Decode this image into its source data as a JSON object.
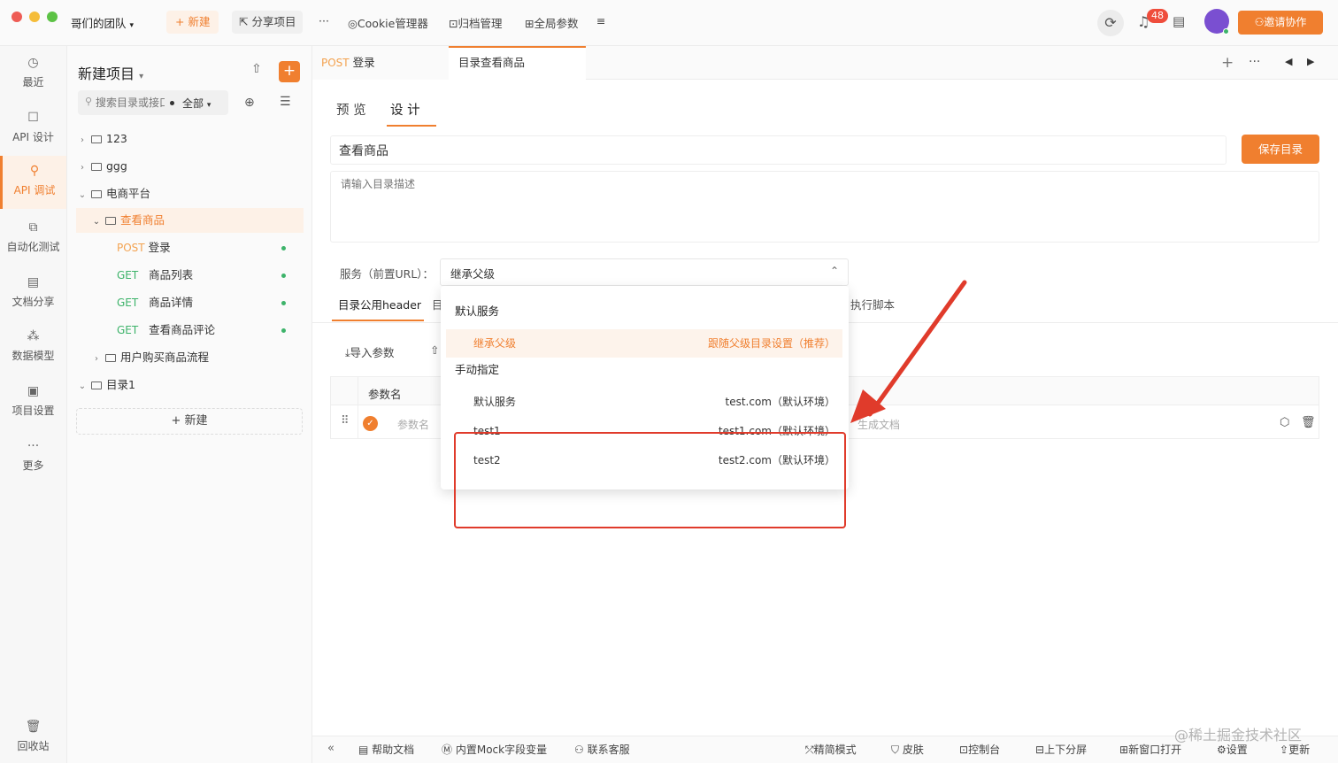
{
  "window": {
    "team": "哥们的团队",
    "new": "+ 新建",
    "share": "分享项目",
    "more": "···",
    "cookie": "Cookie管理器",
    "archive": "归档管理",
    "globals": "全局参数",
    "notify_count": "48",
    "invite": "邀请协作"
  },
  "nav": [
    {
      "label": "最近",
      "icon": "clock-icon"
    },
    {
      "label": "API 设计",
      "icon": "edit-icon"
    },
    {
      "label": "API 调试",
      "icon": "debug-icon"
    },
    {
      "label": "自动化测试",
      "icon": "flow-icon"
    },
    {
      "label": "文档分享",
      "icon": "doc-icon"
    },
    {
      "label": "数据模型",
      "icon": "model-icon"
    },
    {
      "label": "项目设置",
      "icon": "settings-icon"
    },
    {
      "label": "更多",
      "icon": "more-icon"
    }
  ],
  "recycle": "回收站",
  "tree": {
    "project": "新建项目",
    "search_placeholder": "搜索目录或接口",
    "filter": "全部",
    "new_btn": "+ 新建",
    "items": [
      {
        "name": "123"
      },
      {
        "name": "ggg"
      },
      {
        "name": "电商平台"
      },
      {
        "name": "查看商品"
      },
      {
        "method": "POST",
        "name": "登录"
      },
      {
        "method": "GET",
        "name": "商品列表"
      },
      {
        "method": "GET",
        "name": "商品详情"
      },
      {
        "method": "GET",
        "name": "查看商品评论"
      },
      {
        "name": "用户购买商品流程"
      },
      {
        "name": "目录1"
      }
    ]
  },
  "tabs": [
    {
      "method": "POST",
      "label": "登录"
    },
    {
      "label": "目录查看商品"
    }
  ],
  "subtabs": [
    "预 览",
    "设 计"
  ],
  "dir": {
    "name": "查看商品",
    "desc_placeholder": "请输入目录描述",
    "save": "保存目录"
  },
  "service": {
    "label": "服务（前置URL）：",
    "value": "继承父级"
  },
  "section_tabs": {
    "header": "目录公用header",
    "first_char": "目",
    "script": "执行脚本"
  },
  "params": {
    "import": "导入参数",
    "col_name": "参数名",
    "name_placeholder": "参数名",
    "gen_doc": "生成文档"
  },
  "dropdown": {
    "default_title": "默认服务",
    "inherit": "继承父级",
    "inherit_hint": "跟随父级目录设置（推荐）",
    "manual_title": "手动指定",
    "rows": [
      {
        "name": "默认服务",
        "url": "test.com（默认环境）"
      },
      {
        "name": "test1",
        "url": "test1.com（默认环境）"
      },
      {
        "name": "test2",
        "url": "test2.com（默认环境）"
      }
    ]
  },
  "bottom": {
    "help": "帮助文档",
    "mock": "内置Mock字段变量",
    "contact": "联系客服",
    "simple": "精简模式",
    "skin": "皮肤",
    "console": "控制台",
    "split": "上下分屏",
    "newwin": "新窗口打开",
    "settings": "设置",
    "update": "更新"
  },
  "watermark": "@稀土掘金技术社区",
  "colors": {
    "accent": "#f07f2f",
    "get": "#3db36a",
    "post": "#f3a24f",
    "highlight": "#e03b2b"
  }
}
